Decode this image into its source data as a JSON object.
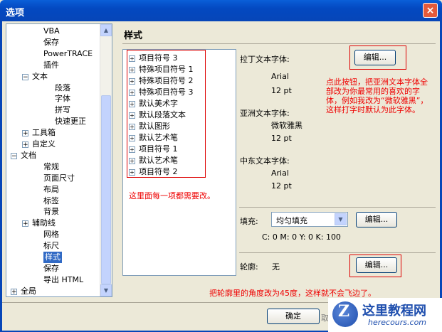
{
  "window": {
    "title": "选项",
    "close_glyph": "×"
  },
  "tree": {
    "items": [
      {
        "label": "VBA",
        "indent": 2
      },
      {
        "label": "保存",
        "indent": 2
      },
      {
        "label": "PowerTRACE",
        "indent": 2
      },
      {
        "label": "插件",
        "indent": 2
      },
      {
        "label": "文本",
        "indent": 1,
        "expander": "−"
      },
      {
        "label": "段落",
        "indent": 3
      },
      {
        "label": "字体",
        "indent": 3
      },
      {
        "label": "拼写",
        "indent": 3
      },
      {
        "label": "快速更正",
        "indent": 3
      },
      {
        "label": "工具箱",
        "indent": 1,
        "expander": "+"
      },
      {
        "label": "自定义",
        "indent": 1,
        "expander": "+"
      },
      {
        "label": "文档",
        "indent": 0,
        "expander": "−"
      },
      {
        "label": "常规",
        "indent": 2
      },
      {
        "label": "页面尺寸",
        "indent": 2
      },
      {
        "label": "布局",
        "indent": 2
      },
      {
        "label": "标签",
        "indent": 2
      },
      {
        "label": "背景",
        "indent": 2
      },
      {
        "label": "辅助线",
        "indent": 1,
        "expander": "+"
      },
      {
        "label": "网格",
        "indent": 2
      },
      {
        "label": "标尺",
        "indent": 2
      },
      {
        "label": "样式",
        "indent": 2,
        "selected": true
      },
      {
        "label": "保存",
        "indent": 2
      },
      {
        "label": "导出 HTML",
        "indent": 2
      },
      {
        "label": "全局",
        "indent": 0,
        "expander": "+"
      }
    ],
    "scroll_up": "▲",
    "scroll_down": "▼"
  },
  "main": {
    "heading": "样式",
    "styles_list": [
      "项目符号 3",
      "特殊项目符号 1",
      "特殊项目符号 2",
      "特殊项目符号 3",
      "默认美术字",
      "默认段落文本",
      "默认图形",
      "默认艺术笔",
      "项目符号 1",
      "默认艺术笔",
      "项目符号 2"
    ],
    "plus_glyph": "+",
    "latin_font_label": "拉丁文本字体:",
    "latin_font_name": "Arial",
    "latin_font_size": "12 pt",
    "asian_font_label": "亚洲文本字体:",
    "asian_font_name": "微软雅黑",
    "asian_font_size": "12 pt",
    "mideast_font_label": "中东文本字体:",
    "mideast_font_name": "Arial",
    "mideast_font_size": "12 pt",
    "edit_label": "编辑...",
    "fill_label": "填充:",
    "fill_value": "均匀填充",
    "fill_cmyk": "C: 0 M: 0 Y: 0 K: 100",
    "outline_label": "轮廓:",
    "outline_value": "无",
    "dropdown_glyph": "▼"
  },
  "annotations": {
    "note_list": "这里面每一项都需要改。",
    "note_font": "点此按钮，把亚洲文本字体全部改为你最常用的喜欢的字体，例如我改为“微软雅黑”，这样打字时默认为此字体。",
    "note_outline": "把轮廓里的角度改为45度，这样就不会飞边了。"
  },
  "footer": {
    "ok_label": "确定",
    "partial_label": "取消"
  },
  "watermark": {
    "logo_letter": "Z",
    "site_cn": "这里教程网",
    "site_en": "herecours.com"
  },
  "colors": {
    "titlebar": "#0348c0",
    "selection": "#316ac5",
    "annotation": "#dd0000"
  }
}
